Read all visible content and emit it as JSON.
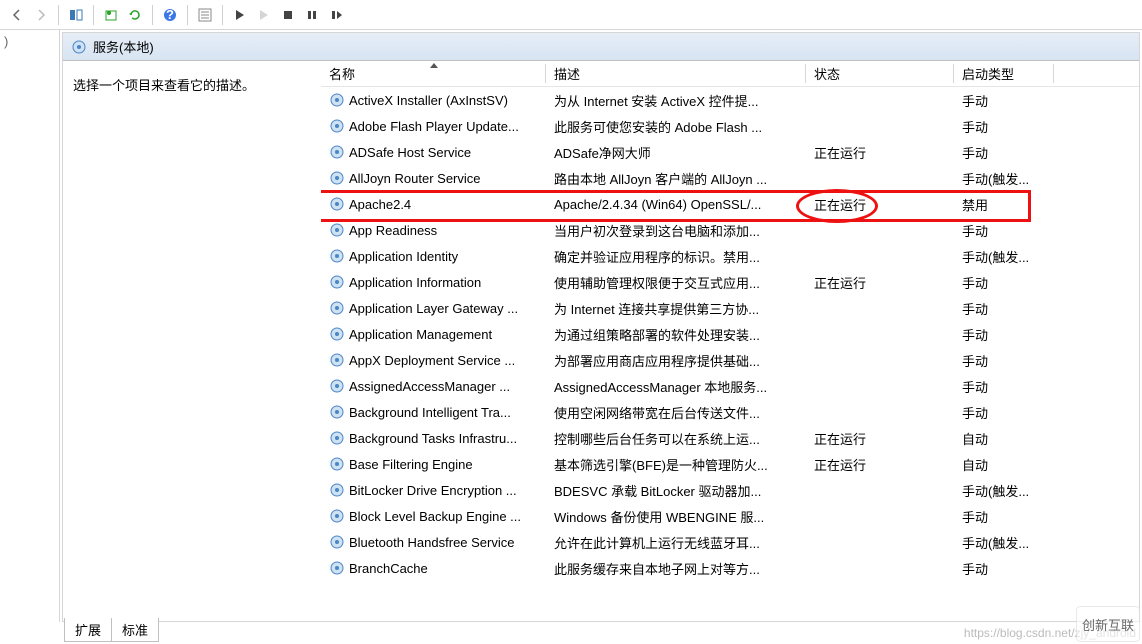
{
  "header_title": "服务(本地)",
  "leftdesc": "选择一个项目来查看它的描述。",
  "columns": {
    "name": "名称",
    "desc": "描述",
    "status": "状态",
    "startup": "启动类型"
  },
  "tabs": {
    "ext": "扩展",
    "std": "标准"
  },
  "watermark": "https://blog.csdn.net/zjy_android",
  "logo_text": "创新互联",
  "services": [
    {
      "name": "ActiveX Installer (AxInstSV)",
      "desc": "为从 Internet 安装 ActiveX 控件提...",
      "status": "",
      "type": "手动"
    },
    {
      "name": "Adobe Flash Player Update...",
      "desc": "此服务可使您安装的 Adobe Flash ...",
      "status": "",
      "type": "手动"
    },
    {
      "name": "ADSafe Host Service",
      "desc": "ADSafe净网大师",
      "status": "正在运行",
      "type": "手动"
    },
    {
      "name": "AllJoyn Router Service",
      "desc": "路由本地 AllJoyn 客户端的 AllJoyn ...",
      "status": "",
      "type": "手动(触发..."
    },
    {
      "name": "Apache2.4",
      "desc": "Apache/2.4.34 (Win64) OpenSSL/...",
      "status": "正在运行",
      "type": "禁用",
      "highlight": true
    },
    {
      "name": "App Readiness",
      "desc": "当用户初次登录到这台电脑和添加...",
      "status": "",
      "type": "手动"
    },
    {
      "name": "Application Identity",
      "desc": "确定并验证应用程序的标识。禁用...",
      "status": "",
      "type": "手动(触发..."
    },
    {
      "name": "Application Information",
      "desc": "使用辅助管理权限便于交互式应用...",
      "status": "正在运行",
      "type": "手动"
    },
    {
      "name": "Application Layer Gateway ...",
      "desc": "为 Internet 连接共享提供第三方协...",
      "status": "",
      "type": "手动"
    },
    {
      "name": "Application Management",
      "desc": "为通过组策略部署的软件处理安装...",
      "status": "",
      "type": "手动"
    },
    {
      "name": "AppX Deployment Service ...",
      "desc": "为部署应用商店应用程序提供基础...",
      "status": "",
      "type": "手动"
    },
    {
      "name": "AssignedAccessManager ...",
      "desc": "AssignedAccessManager 本地服务...",
      "status": "",
      "type": "手动"
    },
    {
      "name": "Background Intelligent Tra...",
      "desc": "使用空闲网络带宽在后台传送文件...",
      "status": "",
      "type": "手动"
    },
    {
      "name": "Background Tasks Infrastru...",
      "desc": "控制哪些后台任务可以在系统上运...",
      "status": "正在运行",
      "type": "自动"
    },
    {
      "name": "Base Filtering Engine",
      "desc": "基本筛选引擎(BFE)是一种管理防火...",
      "status": "正在运行",
      "type": "自动"
    },
    {
      "name": "BitLocker Drive Encryption ...",
      "desc": "BDESVC 承载 BitLocker 驱动器加...",
      "status": "",
      "type": "手动(触发..."
    },
    {
      "name": "Block Level Backup Engine ...",
      "desc": "Windows 备份使用 WBENGINE 服...",
      "status": "",
      "type": "手动"
    },
    {
      "name": "Bluetooth Handsfree Service",
      "desc": "允许在此计算机上运行无线蓝牙耳...",
      "status": "",
      "type": "手动(触发..."
    },
    {
      "name": "BranchCache",
      "desc": "此服务缓存来自本地子网上对等方...",
      "status": "",
      "type": "手动"
    }
  ],
  "toolbar_icons": [
    "back",
    "forward",
    "",
    "show-hide",
    "",
    "export",
    "refresh",
    "",
    "help",
    "",
    "props",
    "",
    "play",
    "",
    "stop",
    "pause",
    "restart"
  ]
}
